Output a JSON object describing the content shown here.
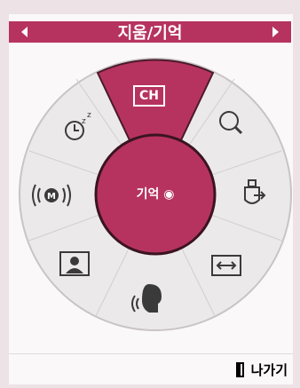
{
  "header": {
    "title": "지움/기억",
    "prev_label": "",
    "next_label": ""
  },
  "wheel": {
    "center_label": "기억 ◉",
    "top_label": "CH",
    "items": [
      {
        "name": "sleep-timer",
        "icon": "clock-zz-icon"
      },
      {
        "name": "search",
        "icon": "magnifier-icon"
      },
      {
        "name": "input",
        "icon": "input-arrow-icon"
      },
      {
        "name": "aspect",
        "icon": "double-arrow-icon"
      },
      {
        "name": "voice",
        "icon": "voice-head-icon"
      },
      {
        "name": "picture",
        "icon": "person-picture-icon"
      },
      {
        "name": "audio",
        "icon": "m-sound-icon"
      }
    ]
  },
  "footer": {
    "exit_label": "나가기"
  },
  "colors": {
    "accent": "#b7335f",
    "ring": "#eceaeb",
    "divider": "#cfcfcf"
  }
}
